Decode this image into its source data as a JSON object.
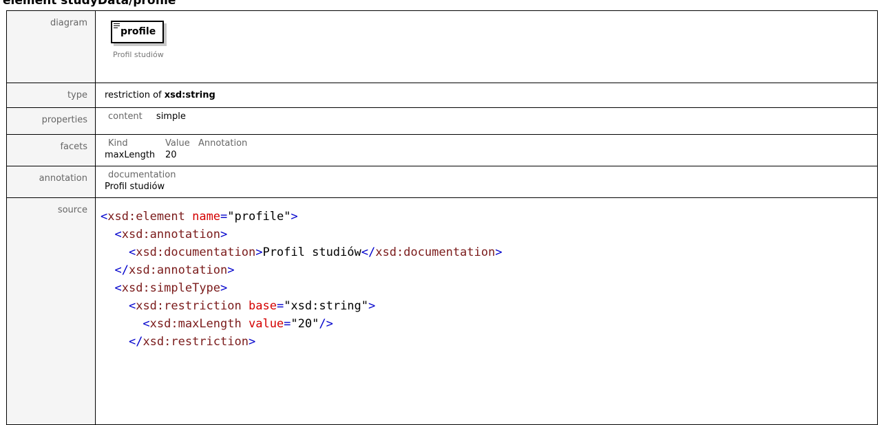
{
  "page": {
    "title": "element studyData/profile"
  },
  "rows": {
    "diagram": {
      "label": "diagram",
      "node_name": "profile",
      "caption": "Profil studiów"
    },
    "type": {
      "label": "type",
      "prefix": "restriction of",
      "base": "xsd:string"
    },
    "properties": {
      "label": "properties",
      "key": "content",
      "value": "simple"
    },
    "facets": {
      "label": "facets",
      "headers": [
        "Kind",
        "Value",
        "Annotation"
      ],
      "rows": [
        {
          "kind": "maxLength",
          "value": "20",
          "annotation": ""
        }
      ]
    },
    "annotation": {
      "label": "annotation",
      "heading": "documentation",
      "text": "Profil studiów"
    },
    "source": {
      "label": "source",
      "lines": [
        {
          "indent": 0,
          "open": "<",
          "tag": "xsd:element",
          "attr": "name",
          "eq": "=",
          "value": "\"profile\"",
          "close": ">"
        },
        {
          "indent": 2,
          "open": "<",
          "tag": "xsd:annotation",
          "close": ">"
        },
        {
          "indent": 4,
          "open": "<",
          "tag": "xsd:documentation",
          "close": ">",
          "text": "Profil studiów",
          "open2": "</",
          "tag2": "xsd:documentation",
          "close2": ">"
        },
        {
          "indent": 2,
          "open": "</",
          "tag": "xsd:annotation",
          "close": ">"
        },
        {
          "indent": 2,
          "open": "<",
          "tag": "xsd:simpleType",
          "close": ">"
        },
        {
          "indent": 4,
          "open": "<",
          "tag": "xsd:restriction",
          "attr": "base",
          "eq": "=",
          "value": "\"xsd:string\"",
          "close": ">"
        },
        {
          "indent": 6,
          "open": "<",
          "tag": "xsd:maxLength",
          "attr": "value",
          "eq": "=",
          "value": "\"20\"",
          "close": "/>"
        },
        {
          "indent": 4,
          "open": "</",
          "tag": "xsd:restriction",
          "close": ">"
        }
      ]
    }
  }
}
